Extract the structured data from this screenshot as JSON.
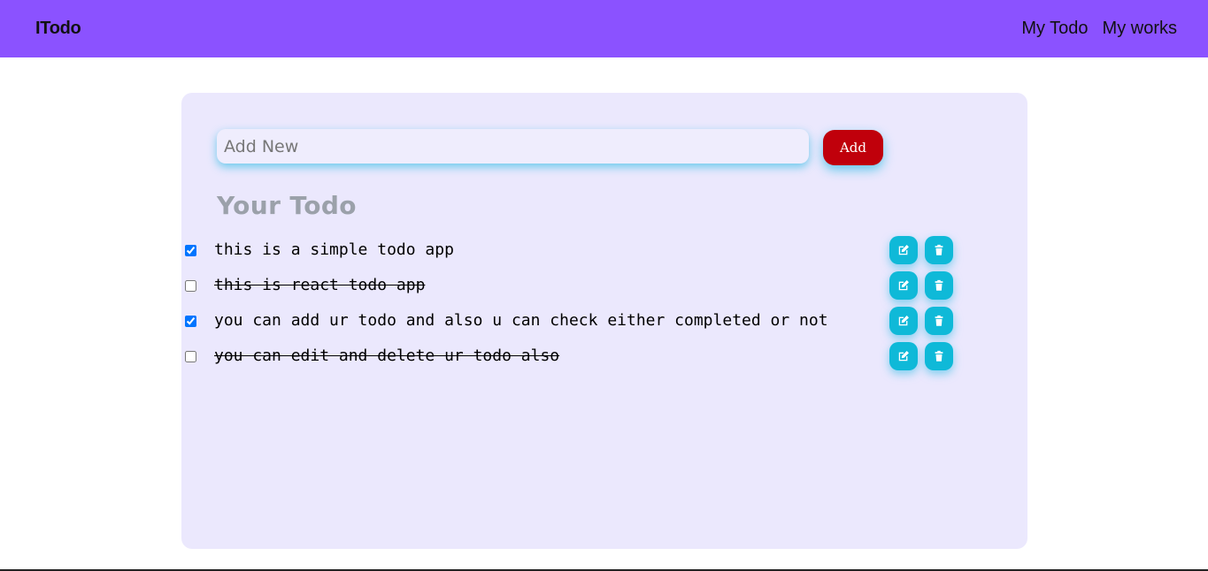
{
  "navbar": {
    "brand": "ITodo",
    "links": [
      "My Todo",
      "My works"
    ]
  },
  "add": {
    "placeholder": "Add New",
    "value": "",
    "button_label": "Add"
  },
  "section_title": "Your Todo",
  "todos": [
    {
      "text": "this is a simple todo app",
      "checked": true,
      "struck": false
    },
    {
      "text": "this is react todo app",
      "checked": false,
      "struck": true
    },
    {
      "text": "you can add ur todo and also u can check either completed or not",
      "checked": true,
      "struck": false
    },
    {
      "text": "you can edit and delete ur todo also",
      "checked": false,
      "struck": true
    }
  ],
  "icons": {
    "edit": "edit-icon",
    "delete": "trash-icon"
  },
  "colors": {
    "navbar": "#8b52ff",
    "card": "#ebe8fd",
    "add_button": "#c0000b",
    "action_button": "#0fb9d8",
    "title": "#9ba1aa"
  }
}
